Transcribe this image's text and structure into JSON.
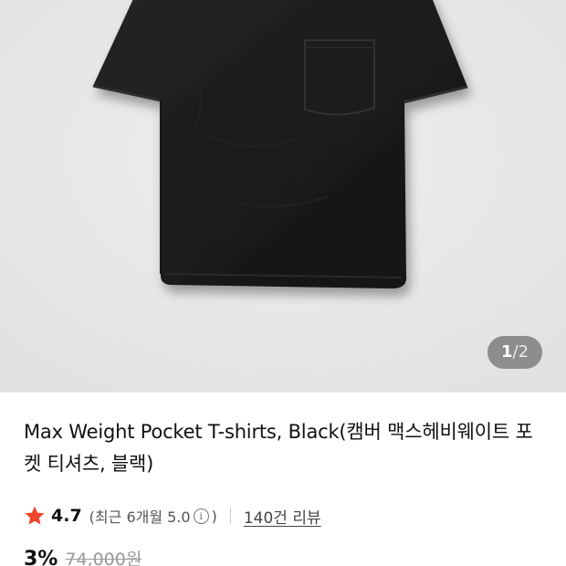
{
  "gallery": {
    "image_subject": "black short-sleeve pocket t-shirt",
    "pager": {
      "current": "1",
      "separator": "/",
      "total": "2"
    },
    "colors": {
      "background": "#eaeaea",
      "shirt": "#1c1c1c",
      "pager_bg": "#8d8d8d"
    }
  },
  "product": {
    "title": "Max Weight Pocket T-shirts, Black(캠버 맥스헤비웨이트 포켓 티셔츠, 블랙)",
    "rating": {
      "star_icon": "star-icon",
      "star_color": "#f0452a",
      "value": "4.7",
      "recent_prefix": "(최근 6개월 5.0",
      "info_icon_glyph": "i",
      "recent_suffix": ")",
      "review_link": "140건 리뷰"
    },
    "price": {
      "discount": "3%",
      "original": "74,000원"
    }
  }
}
